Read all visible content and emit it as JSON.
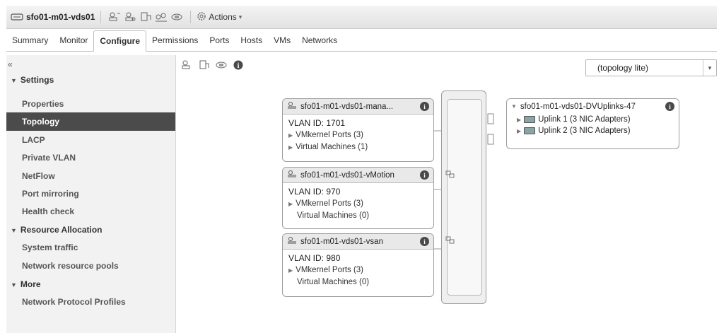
{
  "header": {
    "title": "sfo01-m01-vds01",
    "actions_label": "Actions"
  },
  "tabs": [
    "Summary",
    "Monitor",
    "Configure",
    "Permissions",
    "Ports",
    "Hosts",
    "VMs",
    "Networks"
  ],
  "active_tab": "Configure",
  "leftnav": {
    "collapse_glyph": "«",
    "sections": [
      {
        "label": "Settings",
        "items": [
          "Properties",
          "Topology",
          "LACP",
          "Private VLAN",
          "NetFlow",
          "Port mirroring",
          "Health check"
        ]
      },
      {
        "label": "Resource Allocation",
        "items": [
          "System traffic",
          "Network resource pools"
        ]
      },
      {
        "label": "More",
        "items": [
          "Network Protocol Profiles"
        ]
      }
    ],
    "selected": "Topology"
  },
  "view_select": {
    "value": "(topology lite)"
  },
  "port_groups": [
    {
      "name": "sfo01-m01-vds01-mana...",
      "vlan": "VLAN ID: 1701",
      "rows": [
        {
          "label": "VMkernel Ports (3)",
          "expandable": true
        },
        {
          "label": "Virtual Machines (1)",
          "expandable": true
        }
      ]
    },
    {
      "name": "sfo01-m01-vds01-vMotion",
      "vlan": "VLAN ID: 970",
      "rows": [
        {
          "label": "VMkernel Ports (3)",
          "expandable": true
        },
        {
          "label": "Virtual Machines (0)",
          "expandable": false
        }
      ]
    },
    {
      "name": "sfo01-m01-vds01-vsan",
      "vlan": "VLAN ID: 980",
      "rows": [
        {
          "label": "VMkernel Ports (3)",
          "expandable": true
        },
        {
          "label": "Virtual Machines (0)",
          "expandable": false
        }
      ]
    }
  ],
  "uplinks": {
    "name": "sfo01-m01-vds01-DVUplinks-47",
    "items": [
      "Uplink 1 (3 NIC Adapters)",
      "Uplink 2 (3 NIC Adapters)"
    ]
  },
  "icons": {
    "header": [
      "switch-icon",
      "add-host-icon",
      "manage-hosts-icon",
      "migrate-network-icon",
      "port-group-icon"
    ],
    "toolbar": [
      "add-host-icon",
      "manage-hosts-icon",
      "network-icon",
      "info-icon"
    ]
  }
}
